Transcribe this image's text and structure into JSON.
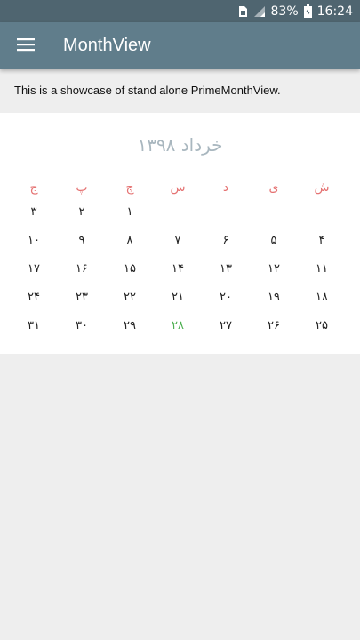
{
  "status_bar": {
    "battery_percent": "83%",
    "time": "16:24"
  },
  "app_bar": {
    "title": "MonthView",
    "menu_icon": "hamburger-menu-icon"
  },
  "description": "This is a showcase of stand alone PrimeMonthView.",
  "calendar": {
    "month_title": "خرداد ۱۳۹۸",
    "weekdays": [
      "ش",
      "ی",
      "د",
      "س",
      "چ",
      "پ",
      "ج"
    ],
    "weeks": [
      [
        "",
        "",
        "",
        "",
        "۱",
        "۲",
        "۳"
      ],
      [
        "۴",
        "۵",
        "۶",
        "۷",
        "۸",
        "۹",
        "۱۰"
      ],
      [
        "۱۱",
        "۱۲",
        "۱۳",
        "۱۴",
        "۱۵",
        "۱۶",
        "۱۷"
      ],
      [
        "۱۸",
        "۱۹",
        "۲۰",
        "۲۱",
        "۲۲",
        "۲۳",
        "۲۴"
      ],
      [
        "۲۵",
        "۲۶",
        "۲۷",
        "۲۸",
        "۲۹",
        "۳۰",
        "۳۱"
      ]
    ],
    "today": "۲۸",
    "colors": {
      "weekday_header": "#e57373",
      "today": "#4caf50",
      "month_title": "#a9b7bf",
      "app_bar": "#607d8b",
      "status_bar": "#4f6570"
    }
  }
}
